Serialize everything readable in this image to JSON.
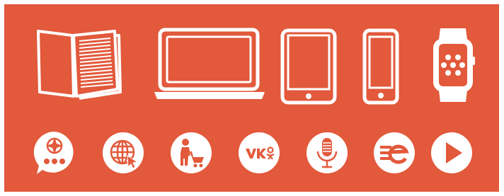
{
  "theme": {
    "background": "#e2593b",
    "foreground": "#ffffff"
  },
  "devices": [
    {
      "icon": "open-book-icon"
    },
    {
      "icon": "laptop-icon"
    },
    {
      "icon": "tablet-icon"
    },
    {
      "icon": "smartphone-icon"
    },
    {
      "icon": "smartwatch-icon"
    }
  ],
  "channels": [
    {
      "icon": "chat-bubble-compass-icon"
    },
    {
      "icon": "globe-cursor-icon"
    },
    {
      "icon": "shopping-cart-person-icon"
    },
    {
      "icon": "vk-odnoklassniki-icon"
    },
    {
      "icon": "microphone-icon"
    },
    {
      "icon": "e-brand-icon"
    },
    {
      "icon": "play-icon"
    }
  ]
}
